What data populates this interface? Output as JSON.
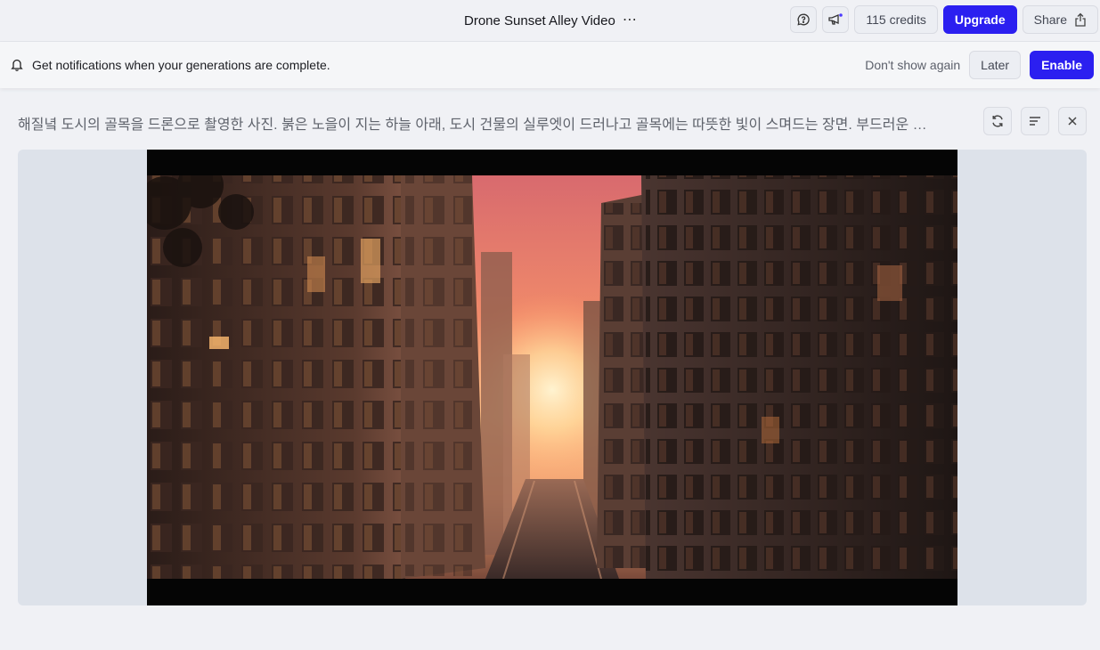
{
  "header": {
    "title": "Drone Sunset Alley Video",
    "more_icon": "more-horizontal-icon",
    "credits_label": "115 credits",
    "upgrade_label": "Upgrade",
    "share_label": "Share"
  },
  "notification": {
    "text": "Get notifications when your generations are complete.",
    "dont_show_label": "Don't show again",
    "later_label": "Later",
    "enable_label": "Enable"
  },
  "prompt": {
    "text": "해질녘 도시의 골목을 드론으로 촬영한 사진. 붉은 노을이 지는 하늘 아래, 도시 건물의 실루엣이 드러나고 골목에는 따뜻한 빛이 스며드는 장면. 부드러운 …"
  },
  "colors": {
    "accent": "#2b1ff0",
    "page_bg": "#f0f1f5",
    "panel_bg": "#dde2ea"
  }
}
